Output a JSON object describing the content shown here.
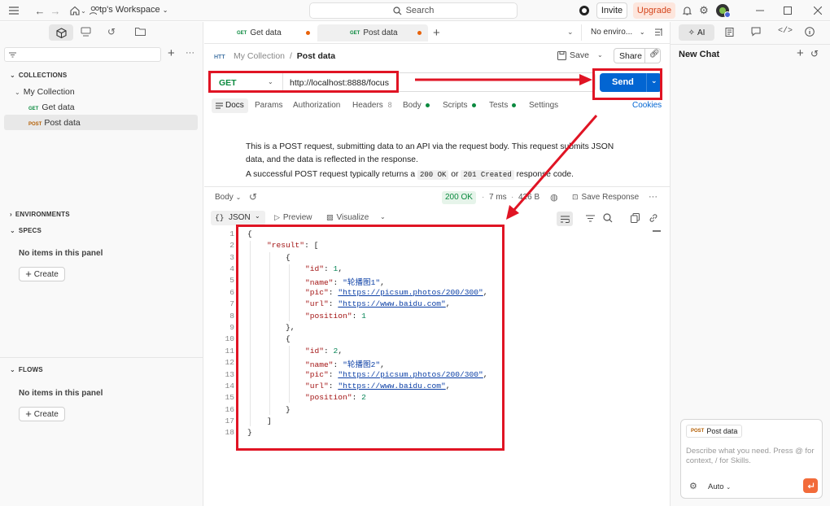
{
  "topbar": {
    "workspace": "tp's Workspace",
    "search": "Search",
    "invite": "Invite",
    "upgrade": "Upgrade"
  },
  "sidebar": {
    "collections_label": "COLLECTIONS",
    "collection_name": "My Collection",
    "requests": [
      {
        "method": "GET",
        "name": "Get data"
      },
      {
        "method": "POST",
        "name": "Post data"
      }
    ],
    "environments_label": "ENVIRONMENTS",
    "specs_label": "SPECS",
    "specs_empty": "No items in this panel",
    "specs_create": "Create",
    "flows_label": "FLOWS",
    "flows_empty": "No items in this panel",
    "flows_create": "Create"
  },
  "tabs": [
    {
      "method": "GET",
      "name": "Get data"
    },
    {
      "method": "GET",
      "name": "Post data"
    }
  ],
  "environment": "No enviro...",
  "request": {
    "breadcrumb_collection": "My Collection",
    "breadcrumb_request": "Post data",
    "save": "Save",
    "share": "Share",
    "method": "GET",
    "url": "http://localhost:8888/focus",
    "send": "Send",
    "subtabs": {
      "docs": "Docs",
      "params": "Params",
      "authorization": "Authorization",
      "headers": "Headers",
      "headers_count": "8",
      "body": "Body",
      "scripts": "Scripts",
      "tests": "Tests",
      "settings": "Settings",
      "cookies": "Cookies"
    },
    "doc_text_1": "This is a POST request, submitting data to an API via the request body. This request submits JSON data, and the data is reflected in the response.",
    "doc_text_2_prefix": "A successful POST request typically returns a",
    "doc_code_1": "200 OK",
    "doc_text_2_or": "or",
    "doc_code_2": "201 Created",
    "doc_text_2_suffix": "response code."
  },
  "response": {
    "body_label": "Body",
    "status": "200 OK",
    "time": "7 ms",
    "size": "426 B",
    "save_response": "Save Response",
    "format": "JSON",
    "preview": "Preview",
    "visualize": "Visualize",
    "line_numbers": [
      "1",
      "2",
      "3",
      "4",
      "5",
      "6",
      "7",
      "8",
      "9",
      "10",
      "11",
      "12",
      "13",
      "14",
      "15",
      "16",
      "17",
      "18"
    ],
    "result_key": "\"result\"",
    "items": [
      {
        "id": "1",
        "name": "\"轮播图1\"",
        "pic": "\"https://picsum.photos/200/300\"",
        "url": "\"https://www.baidu.com\"",
        "position": "1"
      },
      {
        "id": "2",
        "name": "\"轮播图2\"",
        "pic": "\"https://picsum.photos/200/300\"",
        "url": "\"https://www.baidu.com\"",
        "position": "2"
      }
    ],
    "keys": {
      "id": "\"id\"",
      "name": "\"name\"",
      "pic": "\"pic\"",
      "url": "\"url\"",
      "position": "\"position\""
    }
  },
  "ai_panel": {
    "ai_label": "AI",
    "new_chat": "New Chat",
    "context_method": "POST",
    "context_name": "Post data",
    "placeholder": "Describe what you need. Press @ for context, / for Skills.",
    "mode": "Auto"
  },
  "colors": {
    "accent": "#0265d2",
    "annotation": "#e01424",
    "upgrade": "#d4451c",
    "success": "#0b8a3f"
  }
}
